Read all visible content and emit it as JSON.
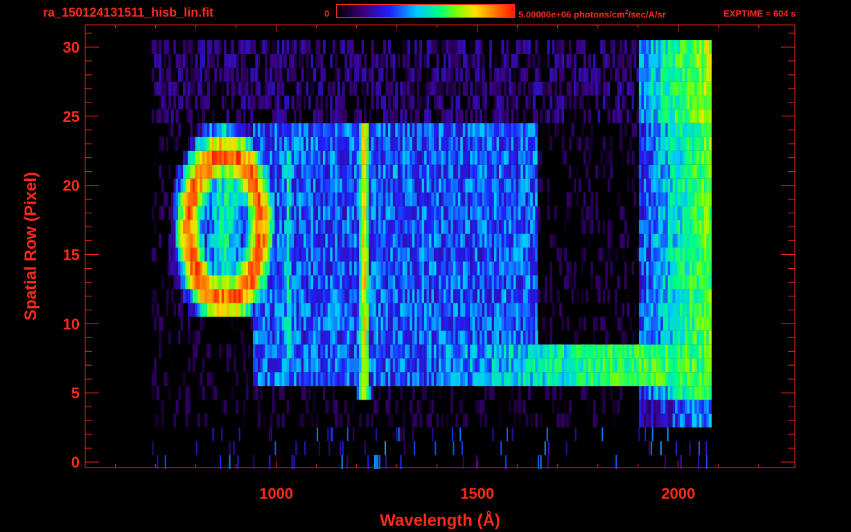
{
  "header": {
    "file_title": "ra_150124131511_hisb_lin.fit",
    "colorbar_min": "0",
    "colorbar_max_prefix": "5.00000e+06 photons/cm",
    "colorbar_max_sup": "2",
    "colorbar_max_suffix": "/sec/A/sr",
    "exptime": "EXPTIME = 604 s"
  },
  "chart_data": {
    "type": "heatmap",
    "title": "ra_150124131511_hisb_lin.fit",
    "xlabel": "Wavelength (Å)",
    "ylabel": "Spatial Row (Pixel)",
    "xlim": [
      525,
      2290
    ],
    "ylim": [
      -0.4,
      31.6
    ],
    "x_ticks": [
      1000,
      1500,
      2000
    ],
    "y_ticks": [
      0,
      5,
      10,
      15,
      20,
      25,
      30
    ],
    "data_x_range": [
      690,
      2080
    ],
    "data_y_range": [
      0,
      30
    ],
    "colorscale": [
      "#000000",
      "#3a007a",
      "#2020ff",
      "#00c8ff",
      "#00ff80",
      "#80ff00",
      "#ffe000",
      "#ff7000",
      "#ff1a00"
    ],
    "colorbar_range": [
      0,
      5000000
    ],
    "colorbar_units": "photons/cm^2/sec/A/sr",
    "features": [
      {
        "name": "ring",
        "x_center": 870,
        "y_center": 17,
        "x_width": 120,
        "y_width": 7,
        "level": 0.9
      },
      {
        "name": "line",
        "x": 1216,
        "y_range": [
          5,
          24
        ],
        "level": 0.75
      },
      {
        "name": "line",
        "x": 1026,
        "y_range": [
          7,
          22
        ],
        "level": 0.45
      },
      {
        "name": "band",
        "x_range": [
          1650,
          2070
        ],
        "y_range": [
          6,
          8
        ],
        "level": 0.55
      }
    ],
    "axis_color": "#ff2a1a",
    "grid": false
  }
}
